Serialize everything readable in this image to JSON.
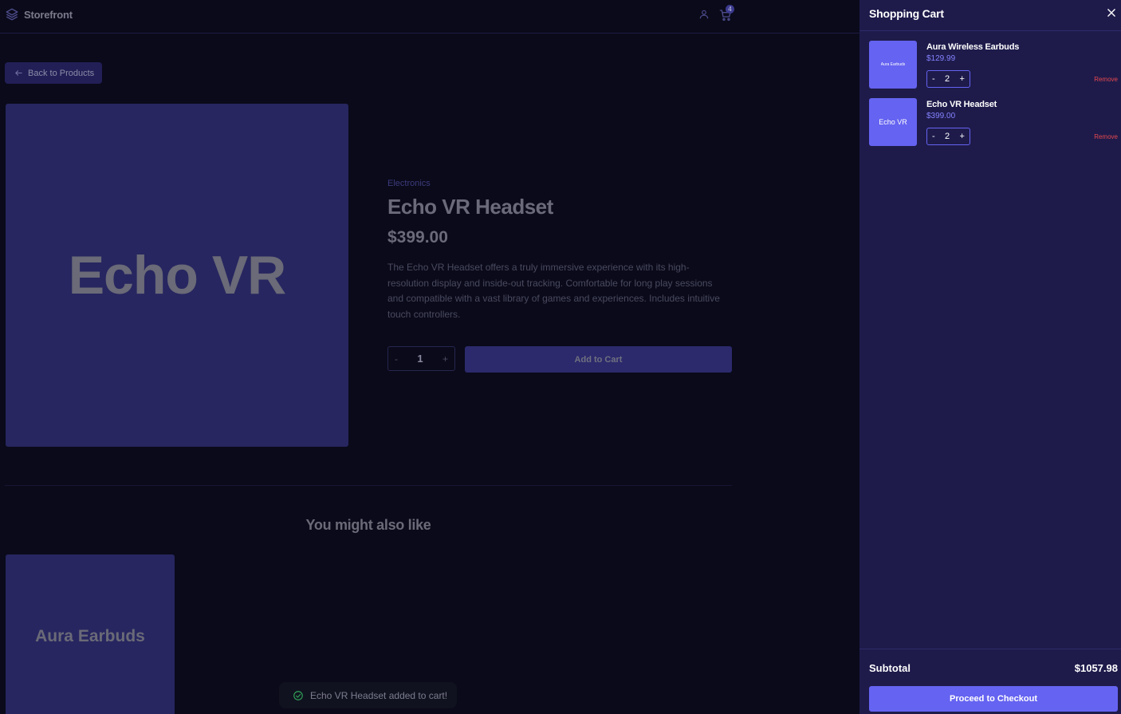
{
  "header": {
    "brand": "Storefront",
    "cart_count": "4"
  },
  "product": {
    "back_label": "Back to Products",
    "image_text": "Echo VR",
    "category": "Electronics",
    "title": "Echo VR Headset",
    "price": "$399.00",
    "description": "The Echo VR Headset offers a truly immersive experience with its high-resolution display and inside-out tracking. Comfortable for long play sessions and compatible with a vast library of games and experiences. Includes intuitive touch controllers.",
    "qty_minus": "-",
    "qty_value": "1",
    "qty_plus": "+",
    "add_to_cart_label": "Add to Cart"
  },
  "related": {
    "title": "You might also like",
    "items": [
      {
        "image_text": "Aura Earbuds"
      }
    ]
  },
  "toast": {
    "message": "Echo VR Headset added to cart!"
  },
  "cart": {
    "title": "Shopping Cart",
    "items": [
      {
        "thumb_text": "Aura Earbuds",
        "name": "Aura Wireless Earbuds",
        "price": "$129.99",
        "qty": "2",
        "minus": "-",
        "plus": "+",
        "remove_label": "Remove"
      },
      {
        "thumb_text": "Echo VR",
        "name": "Echo VR Headset",
        "price": "$399.00",
        "qty": "2",
        "minus": "-",
        "plus": "+",
        "remove_label": "Remove"
      }
    ],
    "subtotal_label": "Subtotal",
    "subtotal_value": "$1057.98",
    "checkout_label": "Proceed to Checkout"
  },
  "colors": {
    "accent": "#6563f1",
    "drawer_bg": "#1e1b4b",
    "remove": "#e5484d",
    "page_bg": "#0a0a1a"
  }
}
